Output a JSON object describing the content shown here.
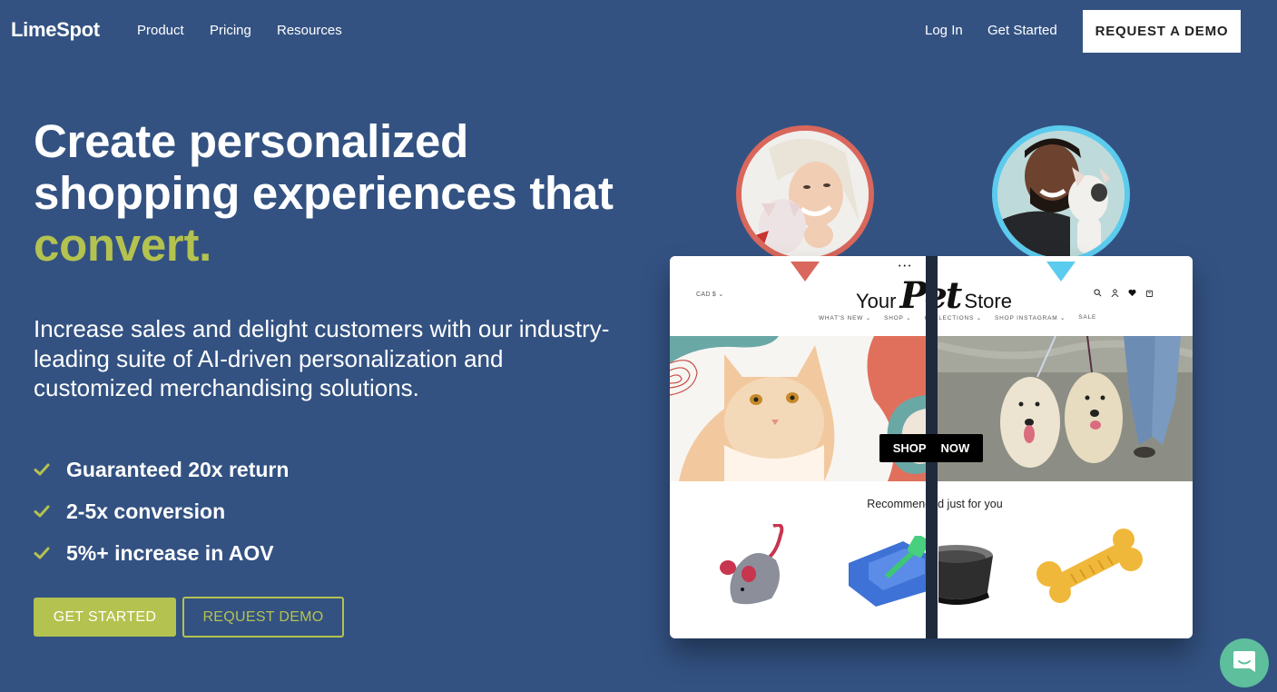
{
  "nav": {
    "logo": "LimeSpot",
    "links": [
      "Product",
      "Pricing",
      "Resources"
    ],
    "login": "Log In",
    "get_started": "Get Started",
    "demo_button": "REQUEST A DEMO"
  },
  "hero": {
    "headline_line1": "Create personalized",
    "headline_line2": "shopping experiences that",
    "headline_accent": "convert.",
    "subtext": "Increase sales and delight customers with our industry-leading suite of AI-driven personalization and customized merchandising solutions.",
    "benefits": [
      {
        "icon": "check-icon",
        "text": "Guaranteed 20x return"
      },
      {
        "icon": "check-icon",
        "text": "2-5x conversion"
      },
      {
        "icon": "check-icon",
        "text": "5%+ increase in AOV"
      }
    ],
    "cta_primary": "GET STARTED",
    "cta_secondary": "REQUEST DEMO"
  },
  "mockup": {
    "currency": "CAD $",
    "store_logo_prefix": "Your",
    "store_logo_script": "Pet",
    "store_logo_suffix": "Store",
    "menu": [
      "WHAT'S NEW",
      "SHOP",
      "COLLECTIONS",
      "SHOP INSTAGRAM",
      "SALE"
    ],
    "icons": [
      "search-icon",
      "account-icon",
      "heart-icon",
      "bag-icon"
    ],
    "shop_now_left": "SHOP",
    "shop_now_right": "NOW",
    "recommended_title": "Recommended just for you",
    "products": [
      "cat-mouse-toy",
      "litter-box",
      "steel-bowl",
      "chew-bone"
    ]
  },
  "colors": {
    "background": "#335282",
    "accent": "#b4c24f",
    "pin_red": "#d9675b",
    "pin_blue": "#5bcbee",
    "chat": "#5dbf9c"
  }
}
